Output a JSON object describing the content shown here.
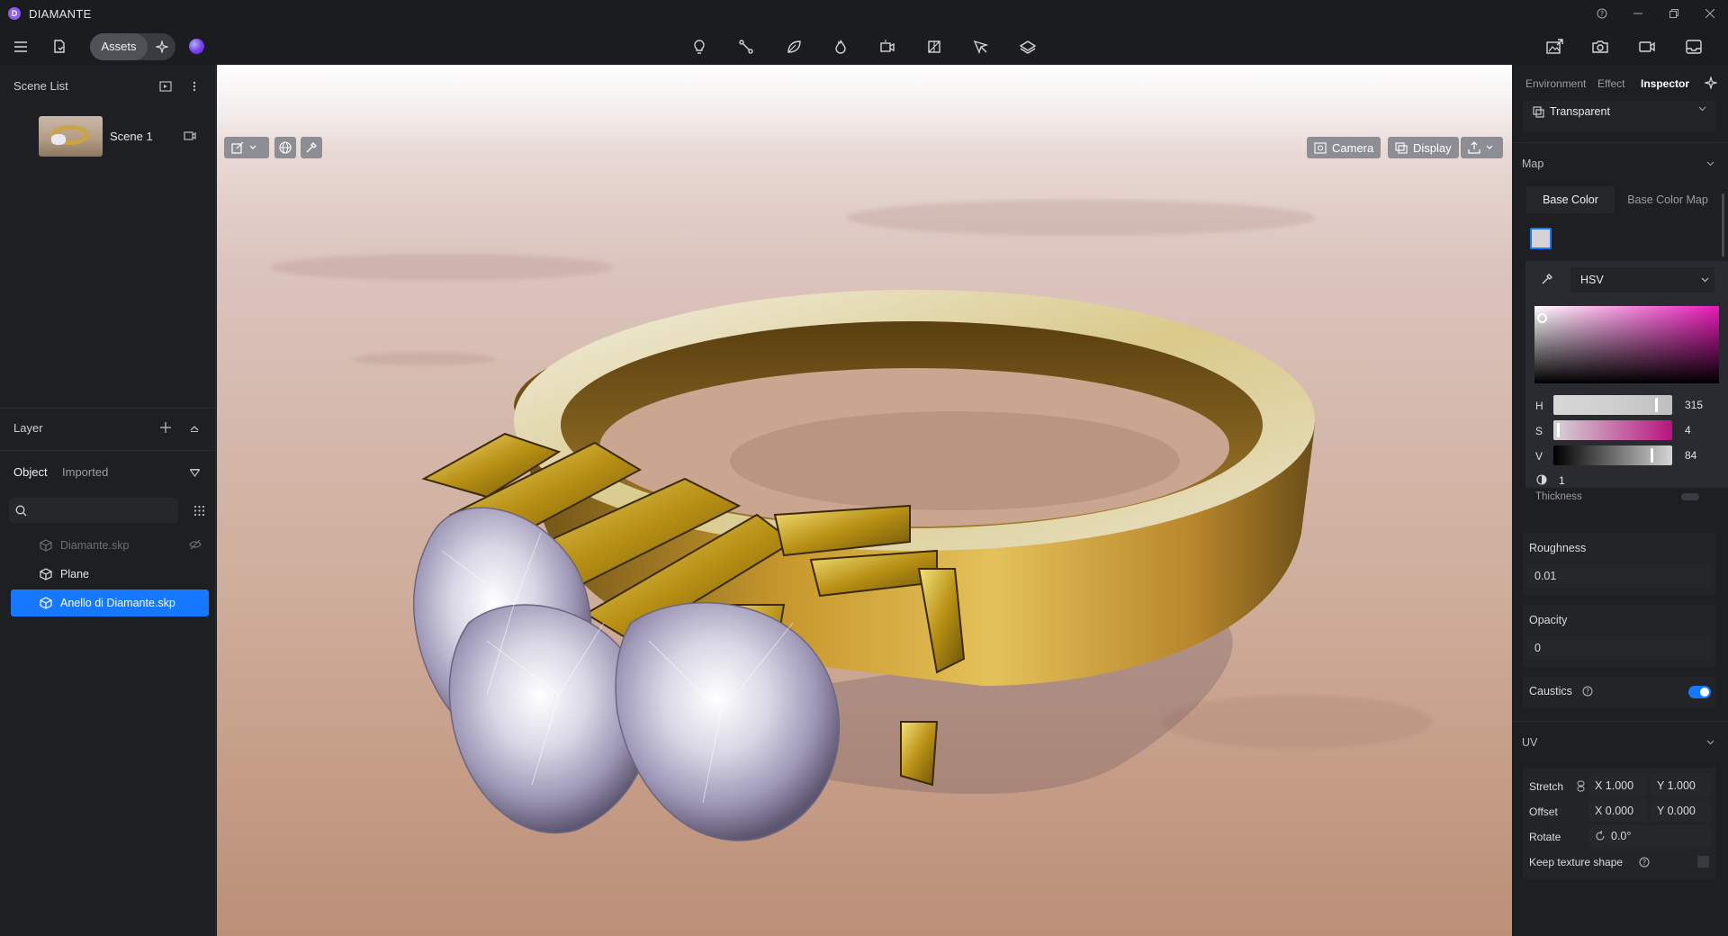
{
  "app": {
    "logo_letter": "D",
    "title": "DIAMANTE"
  },
  "toolbar": {
    "assets_label": "Assets",
    "center_icons": [
      "light-bulb-icon",
      "path-tool-icon",
      "leaf-icon",
      "fire-icon",
      "video-camera-plus-icon",
      "frame-icon",
      "cursor-tool-icon",
      "layers-icon"
    ],
    "right_icons": [
      "export-image-icon",
      "camera-icon",
      "video-icon",
      "inbox-icon"
    ]
  },
  "scene_list": {
    "title": "Scene List",
    "scenes": [
      {
        "name": "Scene 1"
      }
    ]
  },
  "layer": {
    "title": "Layer",
    "tabs": [
      {
        "label": "Object",
        "active": true
      },
      {
        "label": "Imported",
        "active": false
      }
    ],
    "items": [
      {
        "name": "Diamante.skp",
        "state": "hidden"
      },
      {
        "name": "Plane",
        "state": "normal"
      },
      {
        "name": "Anello di Diamante.skp",
        "state": "selected"
      }
    ]
  },
  "viewport": {
    "camera_label": "Camera",
    "display_label": "Display"
  },
  "inspector": {
    "tabs": [
      {
        "label": "Environment",
        "active": false
      },
      {
        "label": "Effect",
        "active": false
      },
      {
        "label": "Inspector",
        "active": true
      }
    ],
    "material_type": "Transparent",
    "map_section": "Map",
    "map_tabs": [
      {
        "label": "Base Color",
        "active": true
      },
      {
        "label": "Base Color Map",
        "active": false
      }
    ],
    "color_mode": "HSV",
    "hsv": {
      "h_label": "H",
      "h_value": "315",
      "s_label": "S",
      "s_value": "4",
      "v_label": "V",
      "v_value": "84"
    },
    "alpha_value": "1",
    "thickness_label": "Thickness",
    "roughness": {
      "label": "Roughness",
      "value": "0.01"
    },
    "opacity": {
      "label": "Opacity",
      "value": "0"
    },
    "caustics": {
      "label": "Caustics",
      "enabled": true
    },
    "uv": {
      "section": "UV",
      "stretch_label": "Stretch",
      "stretch_x": "X  1.000",
      "stretch_y": "Y  1.000",
      "offset_label": "Offset",
      "offset_x": "X  0.000",
      "offset_y": "Y  0.000",
      "rotate_label": "Rotate",
      "rotate_value": "0.0°",
      "keep_texture_label": "Keep texture shape"
    }
  },
  "colors": {
    "accent": "#1677ff",
    "panel_bg": "#1e1f23",
    "toggle_on": "#1677ff"
  }
}
